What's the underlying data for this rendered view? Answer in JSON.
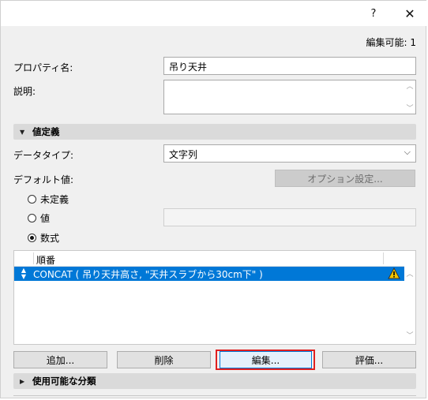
{
  "titlebar": {
    "help_label": "?",
    "close_label": "✕"
  },
  "editable_count": "編集可能: 1",
  "property_name": {
    "label": "プロパティ名:",
    "value": "吊り天井"
  },
  "description": {
    "label": "説明:",
    "value": ""
  },
  "value_definition": {
    "title": "値定義",
    "expanded": true,
    "data_type": {
      "label": "データタイプ:",
      "value": "文字列"
    },
    "default_value": {
      "label": "デフォルト値:",
      "option_button": "オプション設定..."
    },
    "radios": [
      {
        "label": "未定義",
        "selected": false
      },
      {
        "label": "値",
        "selected": false
      },
      {
        "label": "数式",
        "selected": true
      }
    ]
  },
  "formula_list": {
    "header": "順番",
    "rows": [
      {
        "text": "CONCAT ( 吊り天井高さ, \"天井スラブから30cm下\" )",
        "selected": true,
        "warning": true
      }
    ]
  },
  "buttons": {
    "add": "追加...",
    "delete": "削除",
    "edit": "編集...",
    "evaluate": "評価..."
  },
  "available_categories": {
    "title": "使用可能な分類",
    "expanded": false
  },
  "colors": {
    "selection": "#0078d7",
    "highlight_border": "#e02020",
    "warning": "#f5c400"
  }
}
